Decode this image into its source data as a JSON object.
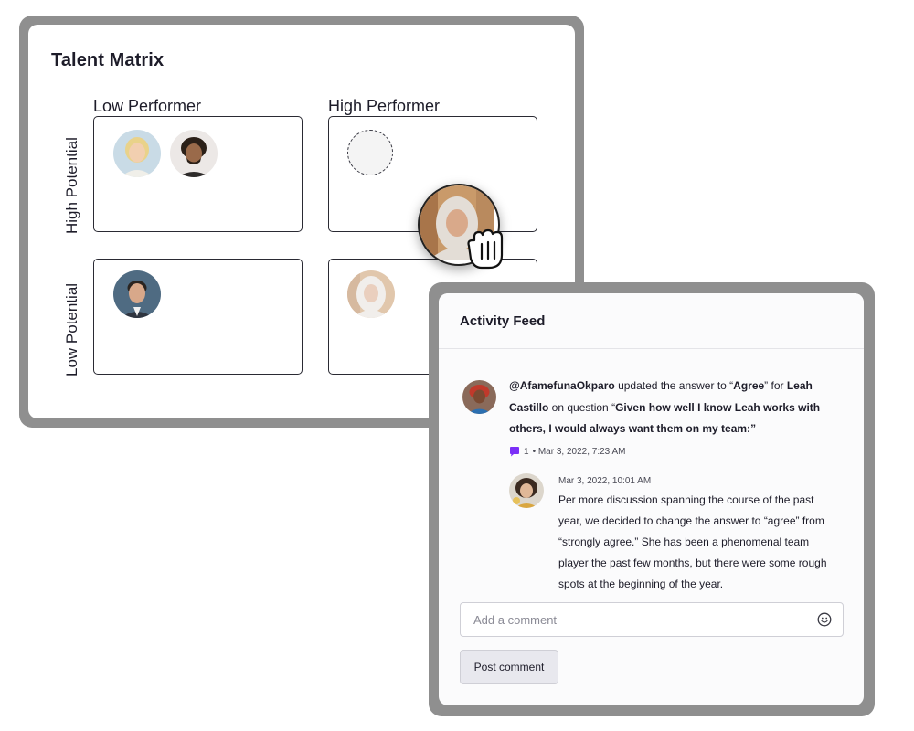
{
  "talent_matrix": {
    "title": "Talent Matrix",
    "column_labels": [
      "Low Performer",
      "High Performer"
    ],
    "row_labels": [
      "High Potential",
      "Low Potential"
    ]
  },
  "activity_feed": {
    "title": "Activity Feed",
    "entry": {
      "user": "@AfamefunaOkparo",
      "action_pre": " updated the answer to “",
      "answer": "Agree",
      "action_mid": "” for ",
      "subject": "Leah Castillo",
      "action_post": " on question “",
      "question": "Given how well I know Leah works with others, I would always want them on my team:",
      "question_close": "”",
      "comment_count": "1",
      "meta": " • Mar 3, 2022, 7:23 AM"
    },
    "reply": {
      "timestamp": "Mar 3, 2022, 10:01 AM",
      "text": "Per more discussion spanning the course of the past year, we decided to change the answer to “agree” from “strongly agree.” She has been a phenomenal team player the past few months, but there were some rough spots at the beginning of the year."
    },
    "comment_placeholder": "Add a comment",
    "post_button_label": "Post comment"
  },
  "colors": {
    "frame": "#8f8f8f",
    "text": "#1d1c29",
    "comment_icon": "#7b2ff7"
  },
  "icons": [
    "grab-hand-icon",
    "comment-bubble-icon",
    "emoji-icon"
  ]
}
